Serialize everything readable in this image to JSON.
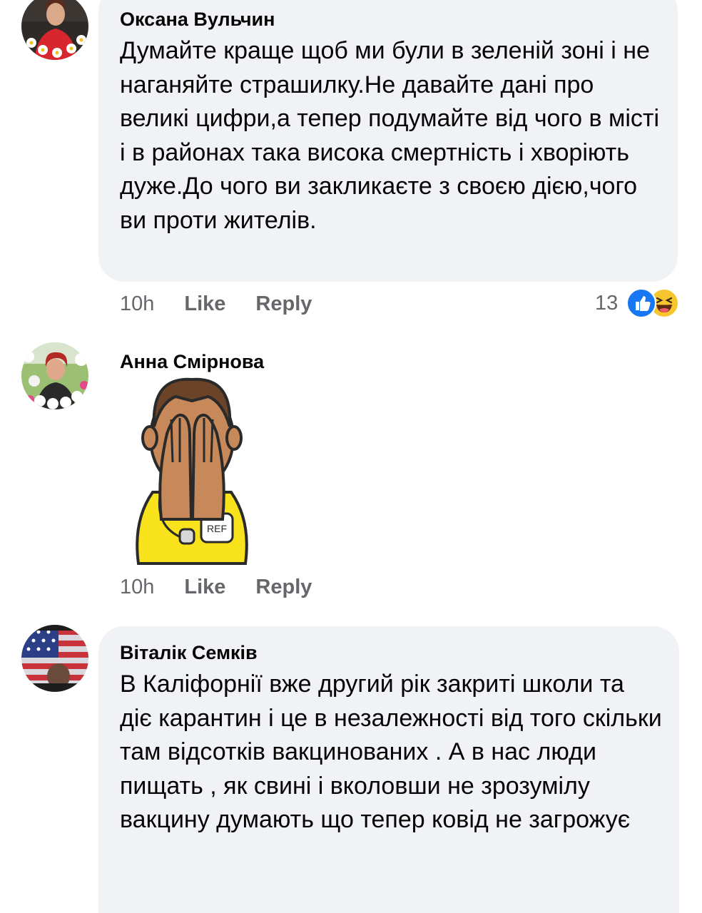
{
  "comments": [
    {
      "author": "Оксана Вульчин",
      "text": "Думайте краще щоб ми були в зеленій зоні і не наганяйте страшилку.Не давайте дані про великі цифри,а тепер подумайте від чого в місті і в районах така висока смертність і хворіють дуже.До чого ви закликаєте з своєю дією,чого ви проти жителів.",
      "time": "10h",
      "like_label": "Like",
      "reply_label": "Reply",
      "reaction_count": "13",
      "reaction_icons": [
        "like-icon",
        "haha-icon"
      ]
    },
    {
      "author": "Анна Смірнова",
      "sticker": "referee-facepalm-sticker",
      "sticker_badge": "REF",
      "time": "10h",
      "like_label": "Like",
      "reply_label": "Reply"
    },
    {
      "author": "Віталік Семків",
      "text": "В Каліфорнії вже другий рік закриті школи та діє карантин і це в незалежності від того скільки там відсотків вакцинованих . А в нас люди пищать , як свині і вколовши не зрозумілу вакцину думають що тепер ковід не загрожує"
    }
  ],
  "colors": {
    "bubble": "#f0f2f5",
    "meta_text": "#65676b",
    "like_blue": "#1877f2",
    "haha_yellow": "#f7c62f"
  }
}
